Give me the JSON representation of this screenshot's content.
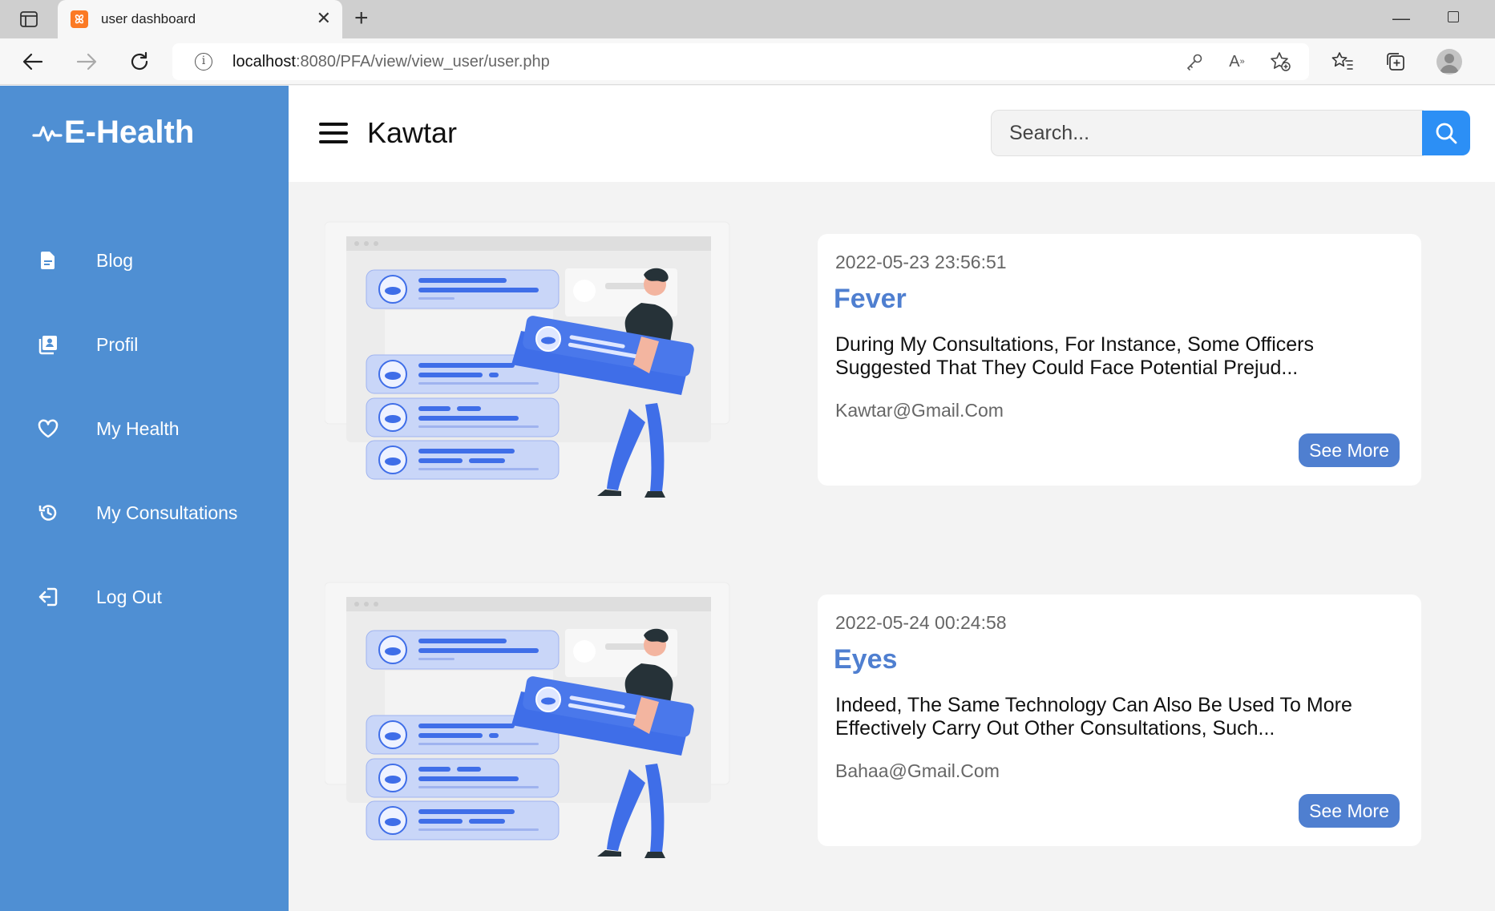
{
  "browser": {
    "tab_title": "user dashboard",
    "url_host": "localhost",
    "url_path": ":8080/PFA/view/view_user/user.php"
  },
  "sidebar": {
    "logo": "E-Health",
    "items": [
      {
        "label": "Blog",
        "icon": "document-icon"
      },
      {
        "label": "Profil",
        "icon": "profile-card-icon"
      },
      {
        "label": "My Health",
        "icon": "heart-icon"
      },
      {
        "label": "My Consultations",
        "icon": "history-icon"
      },
      {
        "label": "Log Out",
        "icon": "logout-icon"
      }
    ]
  },
  "header": {
    "user_name": "Kawtar",
    "search_placeholder": "Search..."
  },
  "posts": [
    {
      "date": "2022-05-23 23:56:51",
      "title": "Fever",
      "body": "During My Consultations, For Instance, Some Officers Suggested That They Could Face Potential Prejud...",
      "author": "Kawtar@Gmail.Com",
      "button": "See More"
    },
    {
      "date": "2022-05-24 00:24:58",
      "title": "Eyes",
      "body": "Indeed, The Same Technology Can Also Be Used To More Effectively Carry Out Other Consultations, Such...",
      "author": "Bahaa@Gmail.Com",
      "button": "See More"
    }
  ],
  "colors": {
    "sidebar": "#4f8fd3",
    "accent": "#4f7fd0",
    "search_button": "#2c8ff5"
  }
}
